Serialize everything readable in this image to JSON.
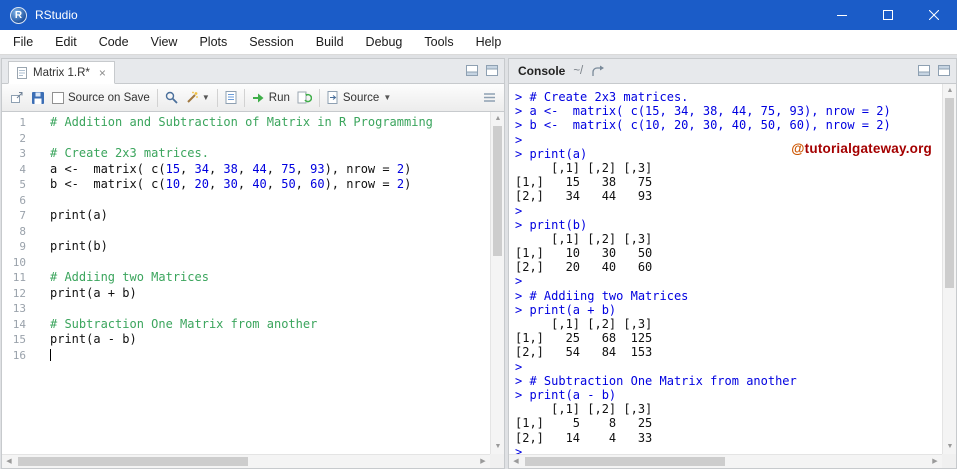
{
  "window": {
    "title": "RStudio"
  },
  "menu": [
    "File",
    "Edit",
    "Code",
    "View",
    "Plots",
    "Session",
    "Build",
    "Debug",
    "Tools",
    "Help"
  ],
  "source_pane": {
    "tab_label": "Matrix 1.R*",
    "tab_close": "×",
    "toolbar": {
      "source_on_save": "Source on Save",
      "run": "Run",
      "source": "Source"
    },
    "code_lines": [
      {
        "n": 1,
        "segs": [
          [
            "c",
            "# Addition and Subtraction of Matrix in R Programming"
          ]
        ]
      },
      {
        "n": 2,
        "segs": []
      },
      {
        "n": 3,
        "segs": [
          [
            "c",
            "# Create 2x3 matrices."
          ]
        ]
      },
      {
        "n": 4,
        "segs": [
          [
            "p",
            "a <-  matrix( c("
          ],
          [
            "n",
            "15"
          ],
          [
            "p",
            ", "
          ],
          [
            "n",
            "34"
          ],
          [
            "p",
            ", "
          ],
          [
            "n",
            "38"
          ],
          [
            "p",
            ", "
          ],
          [
            "n",
            "44"
          ],
          [
            "p",
            ", "
          ],
          [
            "n",
            "75"
          ],
          [
            "p",
            ", "
          ],
          [
            "n",
            "93"
          ],
          [
            "p",
            "), nrow = "
          ],
          [
            "n",
            "2"
          ],
          [
            "p",
            ")"
          ]
        ]
      },
      {
        "n": 5,
        "segs": [
          [
            "p",
            "b <-  matrix( c("
          ],
          [
            "n",
            "10"
          ],
          [
            "p",
            ", "
          ],
          [
            "n",
            "20"
          ],
          [
            "p",
            ", "
          ],
          [
            "n",
            "30"
          ],
          [
            "p",
            ", "
          ],
          [
            "n",
            "40"
          ],
          [
            "p",
            ", "
          ],
          [
            "n",
            "50"
          ],
          [
            "p",
            ", "
          ],
          [
            "n",
            "60"
          ],
          [
            "p",
            "), nrow = "
          ],
          [
            "n",
            "2"
          ],
          [
            "p",
            ")"
          ]
        ]
      },
      {
        "n": 6,
        "segs": []
      },
      {
        "n": 7,
        "segs": [
          [
            "p",
            "print(a)"
          ]
        ]
      },
      {
        "n": 8,
        "segs": []
      },
      {
        "n": 9,
        "segs": [
          [
            "p",
            "print(b)"
          ]
        ]
      },
      {
        "n": 10,
        "segs": []
      },
      {
        "n": 11,
        "segs": [
          [
            "c",
            "# Addiing two Matrices"
          ]
        ]
      },
      {
        "n": 12,
        "segs": [
          [
            "p",
            "print(a + b)"
          ]
        ]
      },
      {
        "n": 13,
        "segs": []
      },
      {
        "n": 14,
        "segs": [
          [
            "c",
            "# Subtraction One Matrix from another"
          ]
        ]
      },
      {
        "n": 15,
        "segs": [
          [
            "p",
            "print(a - b)"
          ]
        ]
      },
      {
        "n": 16,
        "segs": [],
        "cursor": true
      }
    ]
  },
  "console_pane": {
    "title": "Console",
    "path": "~/",
    "watermark": {
      "at": "@",
      "rest": "tutorialgateway.org"
    },
    "lines": [
      [
        "in",
        "> # Create 2x3 matrices."
      ],
      [
        "in",
        "> a <-  matrix( c(15, 34, 38, 44, 75, 93), nrow = 2)"
      ],
      [
        "in",
        "> b <-  matrix( c(10, 20, 30, 40, 50, 60), nrow = 2)"
      ],
      [
        "in",
        "> "
      ],
      [
        "in",
        "> print(a)"
      ],
      [
        "out",
        "     [,1] [,2] [,3]"
      ],
      [
        "out",
        "[1,]   15   38   75"
      ],
      [
        "out",
        "[2,]   34   44   93"
      ],
      [
        "in",
        "> "
      ],
      [
        "in",
        "> print(b)"
      ],
      [
        "out",
        "     [,1] [,2] [,3]"
      ],
      [
        "out",
        "[1,]   10   30   50"
      ],
      [
        "out",
        "[2,]   20   40   60"
      ],
      [
        "in",
        "> "
      ],
      [
        "in",
        "> # Addiing two Matrices"
      ],
      [
        "in",
        "> print(a + b)"
      ],
      [
        "out",
        "     [,1] [,2] [,3]"
      ],
      [
        "out",
        "[1,]   25   68  125"
      ],
      [
        "out",
        "[2,]   54   84  153"
      ],
      [
        "in",
        "> "
      ],
      [
        "in",
        "> # Subtraction One Matrix from another"
      ],
      [
        "in",
        "> print(a - b)"
      ],
      [
        "out",
        "     [,1] [,2] [,3]"
      ],
      [
        "out",
        "[1,]    5    8   25"
      ],
      [
        "out",
        "[2,]   14    4   33"
      ],
      [
        "in",
        "> "
      ]
    ]
  },
  "colors": {
    "titlebar": "#1b5cc8",
    "comment": "#3ba55d",
    "number": "#0000e0",
    "console_input": "#0000e0",
    "watermark_red": "#a40000",
    "watermark_orange": "#cc5500",
    "run_green": "#3fae49"
  }
}
